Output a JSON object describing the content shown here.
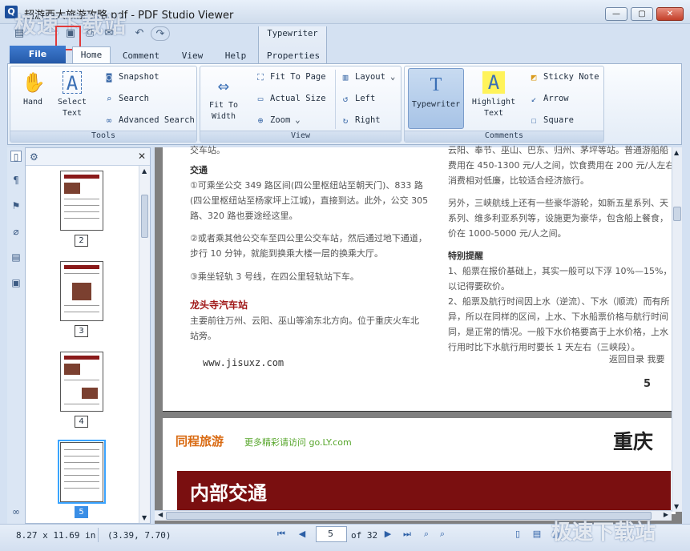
{
  "window": {
    "title": "超游西大旅游攻略.pdf - PDF Studio Viewer",
    "app_icon": "Q",
    "minimize": "—",
    "maximize": "▢",
    "close": "✕",
    "watermark": "极速下载站"
  },
  "quick_access": [
    "open-icon",
    "save-icon",
    "print-icon",
    "email-icon",
    "undo-icon",
    "redo-icon"
  ],
  "context_group": "Typewriter",
  "tabs": {
    "file": "File",
    "items": [
      "Home",
      "Comment",
      "View",
      "Help"
    ],
    "context_tab": "Properties"
  },
  "ribbon": {
    "tools": {
      "label": "Tools",
      "hand": "Hand",
      "select_text": [
        "Select",
        "Text"
      ],
      "snapshot": "Snapshot",
      "search": "Search",
      "advanced_search": "Advanced Search"
    },
    "view": {
      "label": "View",
      "fit_to_width": [
        "Fit To",
        "Width"
      ],
      "fit_to_page": "Fit To Page",
      "actual_size": "Actual Size",
      "zoom": "Zoom",
      "layout": "Layout",
      "left": "Left",
      "right": "Right"
    },
    "comments": {
      "label": "Comments",
      "typewriter": "Typewriter",
      "highlight_text": [
        "Highlight",
        "Text"
      ],
      "sticky_note": "Sticky Note",
      "arrow": "Arrow",
      "square": "Square"
    }
  },
  "thumbnails": {
    "pages": [
      "2",
      "3",
      "4",
      "5"
    ],
    "selected": "5"
  },
  "document": {
    "left_col": {
      "top_fragment": "交车站。",
      "heading_transport": "交通",
      "para1": [
        "①可乘坐公交 349 路区间(四公里枢纽站至朝天门)、833 路",
        "(四公里枢纽站至杨家坪上江城)，直接到达。此外，公交 305",
        "路、320 路也要途经这里。"
      ],
      "para2": [
        "②或者乘其他公交车至四公里公交车站，然后通过地下通道，",
        "步行 10 分钟，就能到换乘大楼一层的换乘大厅。"
      ],
      "para3": "③乘坐轻轨 3 号线，在四公里轻轨站下车。",
      "heading_station": "龙头寺汽车站",
      "para4": [
        "主要前往万州、云阳、巫山等渝东北方向。位于重庆火车北",
        "站旁。"
      ],
      "url": "www.jisuxz.com"
    },
    "right_col": {
      "p1": [
        "云阳、奉节、巫山、巴东、归州、茅坪等站。普通游船船",
        "费用在 450-1300 元/人之间，饮食费用在 200 元/人左右",
        "消费相对低廉，比较适合经济旅行。"
      ],
      "p2": [
        "另外，三峡航线上还有一些豪华游轮，如新五星系列、天",
        "系列、维多利亚系列等，设施更为豪华，包含船上餐食，",
        "价在 1000-5000 元/人之间。"
      ],
      "heading_tips": "特别提醒",
      "tip1": [
        "1、船票在报价基础上，其实一般可以下浮 10%—15%，",
        "以记得要砍价。"
      ],
      "tip2": [
        "2、船票及航行时间因上水（逆流）、下水（顺流）而有所",
        "异，所以在同样的区间，上水、下水船票价格与航行时间",
        "同，是正常的情况。一般下水价格要高于上水价格，上水",
        "行用时比下水航行用时要长 1 天左右（三峡段）。"
      ],
      "back_links": "返回目录    我要",
      "page_number": "5"
    },
    "page2": {
      "brand": "同程旅游",
      "brand_tagline": "更多精彩请访问 go.LY.com",
      "city": "重庆",
      "banner": "内部交通"
    }
  },
  "status": {
    "page_size": "8.27 x 11.69 in",
    "cursor": "(3.39, 7.70)",
    "current_page": "5",
    "total_pages": "of 32",
    "watermark": "极速下载站"
  },
  "colors": {
    "accent": "#2559a8",
    "doc_red": "#8a1a1a",
    "thumb_select": "#39a3ff"
  }
}
